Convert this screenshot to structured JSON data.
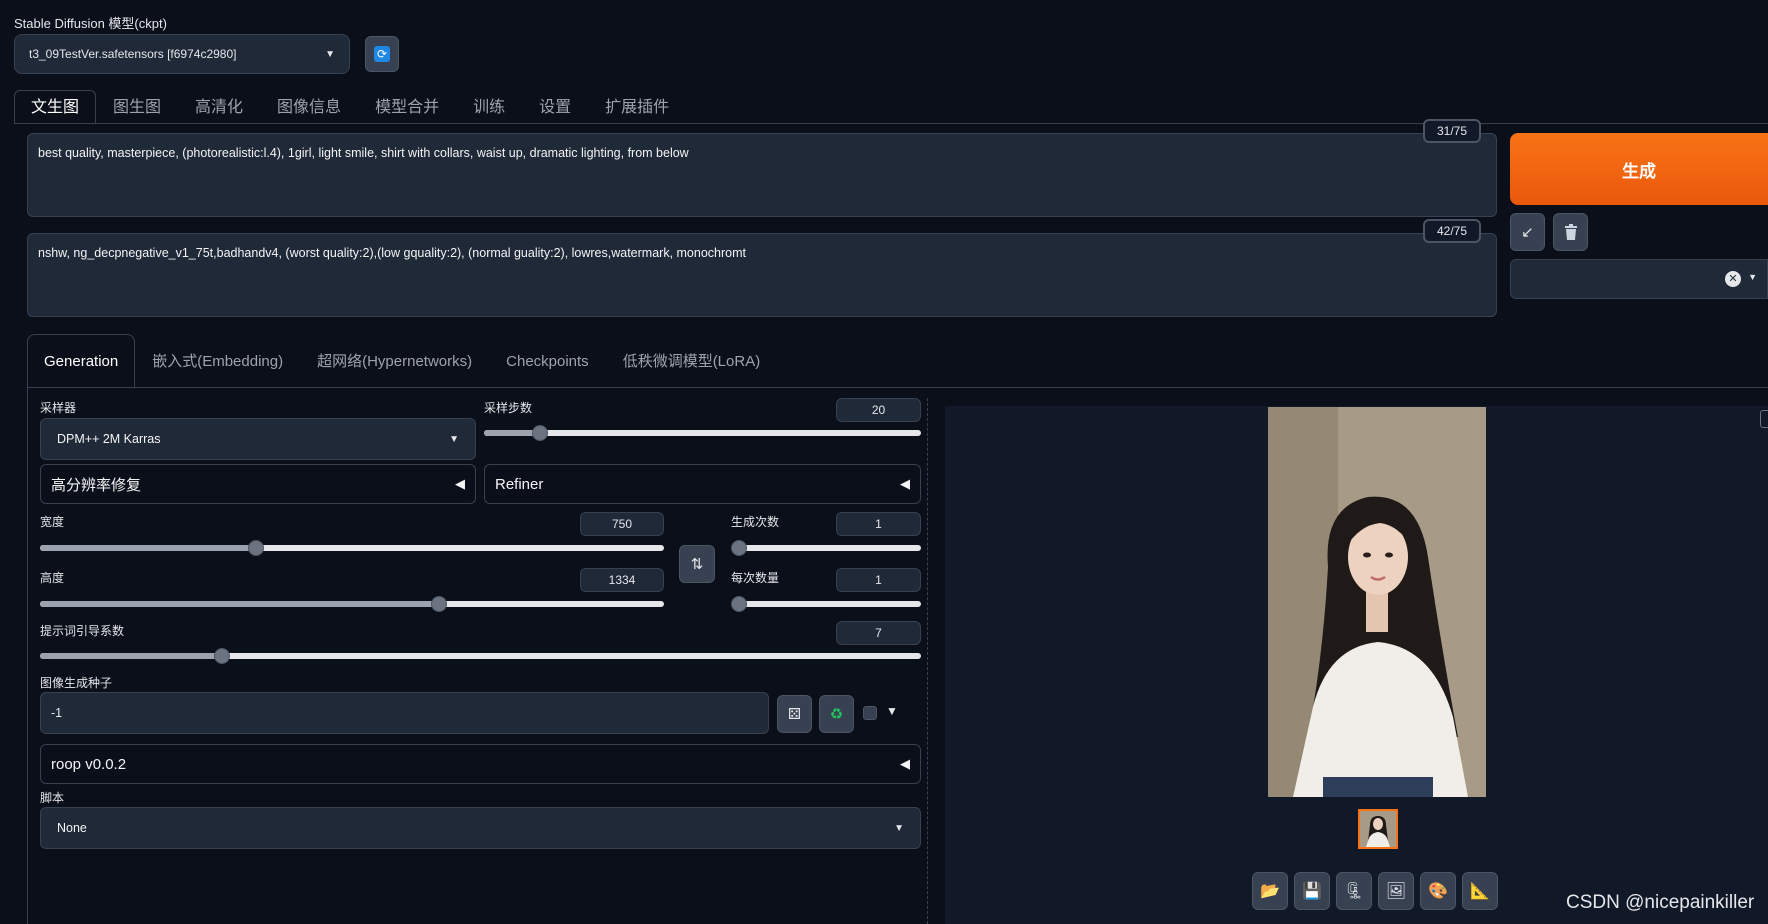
{
  "model": {
    "label": "Stable Diffusion 模型(ckpt)",
    "selected": "t3_09TestVer.safetensors [f6974c2980]",
    "refresh_icon": "refresh-icon"
  },
  "top_tabs": [
    "文生图",
    "图生图",
    "高清化",
    "图像信息",
    "模型合并",
    "训练",
    "设置",
    "扩展插件"
  ],
  "prompt": {
    "positive": "best quality, masterpiece, (photorealistic:l.4), 1girl, light smile, shirt with collars, waist up, dramatic lighting, from below",
    "positive_count": "31/75",
    "negative": "nshw, ng_decpnegative_v1_75t,badhandv4, (worst quality:2),(low gquality:2), (normal guality:2), lowres,watermark, monochromt",
    "negative_count": "42/75"
  },
  "actions": {
    "generate_label": "生成",
    "paste_icon": "arrow-paste-icon",
    "trash_icon": "trash-icon",
    "style_clear_icon": "close-icon"
  },
  "sub_tabs": [
    "Generation",
    "嵌入式(Embedding)",
    "超网络(Hypernetworks)",
    "Checkpoints",
    "低秩微调模型(LoRA)"
  ],
  "generation": {
    "sampler_label": "采样器",
    "sampler_value": "DPM++ 2M Karras",
    "steps_label": "采样步数",
    "steps_value": "20",
    "steps": {
      "value": 20,
      "min": 1,
      "max": 150
    },
    "hires_label": "高分辨率修复",
    "refiner_label": "Refiner",
    "width_label": "宽度",
    "width_value": "750",
    "width": {
      "value": 750,
      "min": 64,
      "max": 2048
    },
    "height_label": "高度",
    "height_value": "1334",
    "height": {
      "value": 1334,
      "min": 64,
      "max": 2048
    },
    "batch_count_label": "生成次数",
    "batch_count_value": "1",
    "batch_count": {
      "value": 1,
      "min": 1,
      "max": 100
    },
    "batch_size_label": "每次数量",
    "batch_size_value": "1",
    "batch_size": {
      "value": 1,
      "min": 1,
      "max": 8
    },
    "cfg_label": "提示词引导系数",
    "cfg_value": "7",
    "cfg": {
      "value": 7,
      "min": 1,
      "max": 30
    },
    "seed_label": "图像生成种子",
    "seed_value": "-1",
    "swap_icon": "swap-icon",
    "dice_icon": "dice-icon",
    "recycle_icon": "recycle-icon",
    "extra_icon": "triangle-down-icon",
    "roop_label": "roop v0.0.2",
    "script_label": "脚本",
    "script_value": "None"
  },
  "output": {
    "toolbar_icons": [
      "folder-icon",
      "save-icon",
      "zip-icon",
      "image-icon",
      "palette-icon",
      "ruler-icon"
    ]
  },
  "watermark": "CSDN @nicepainkiller"
}
